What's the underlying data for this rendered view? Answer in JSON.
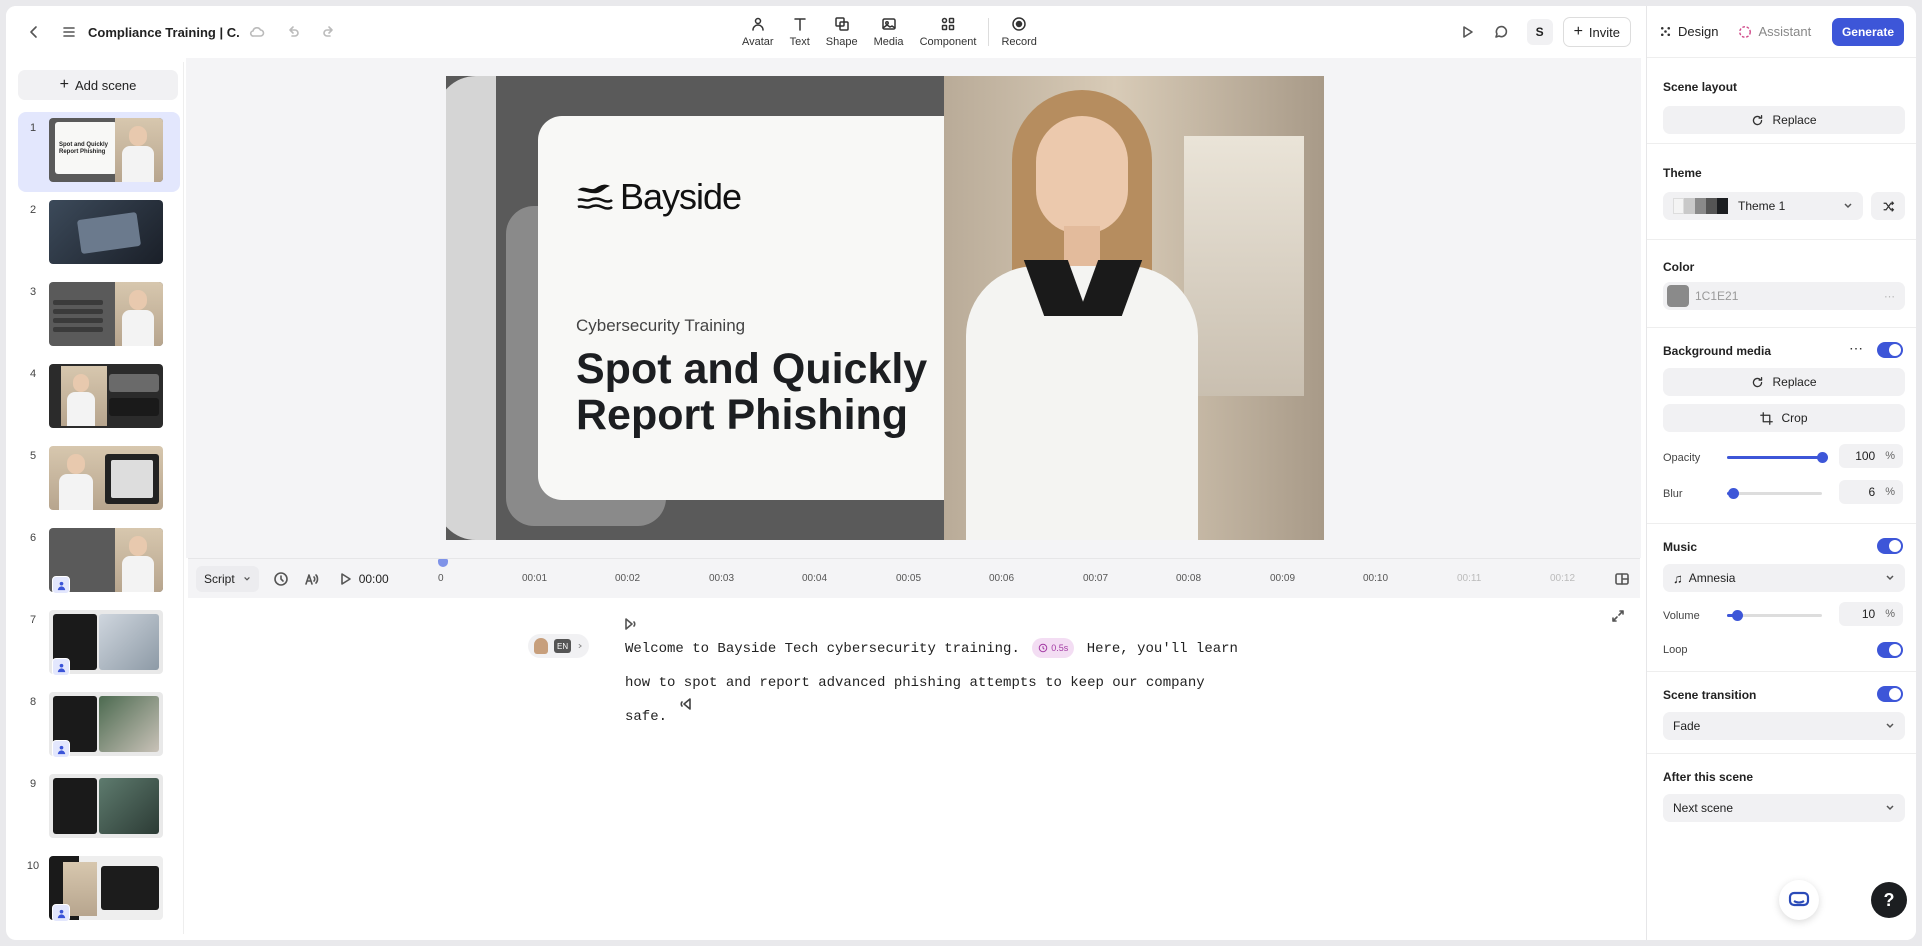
{
  "header": {
    "title": "Compliance Training | C...",
    "invite_label": "Invite",
    "user_initial": "S",
    "tools": [
      {
        "label": "Avatar",
        "icon": "avatar-icon"
      },
      {
        "label": "Text",
        "icon": "text-icon"
      },
      {
        "label": "Shape",
        "icon": "shape-icon"
      },
      {
        "label": "Media",
        "icon": "media-icon"
      },
      {
        "label": "Component",
        "icon": "component-icon"
      },
      {
        "label": "Record",
        "icon": "record-icon"
      }
    ]
  },
  "sidebar": {
    "add_scene_label": "Add scene",
    "scenes": [
      {
        "num": "1",
        "title_line1": "Spot and Quickly",
        "title_line2": "Report  Phishing"
      },
      {
        "num": "2"
      },
      {
        "num": "3"
      },
      {
        "num": "4"
      },
      {
        "num": "5"
      },
      {
        "num": "6"
      },
      {
        "num": "7"
      },
      {
        "num": "8"
      },
      {
        "num": "9"
      },
      {
        "num": "10"
      }
    ]
  },
  "slide": {
    "brand": "Bayside",
    "subtitle": "Cybersecurity Training",
    "title_line1": "Spot and Quickly",
    "title_line2": "Report  Phishing"
  },
  "timeline": {
    "script_label": "Script",
    "time": "00:00",
    "ticks": [
      "0",
      "00:01",
      "00:02",
      "00:03",
      "00:04",
      "00:05",
      "00:06",
      "00:07",
      "00:08",
      "00:09",
      "00:10",
      "00:11",
      "00:12"
    ]
  },
  "script": {
    "lang": "EN",
    "part1": "Welcome to Bayside Tech cybersecurity training.",
    "pause": "0.5s",
    "part2": "Here, you'll learn how to spot and report advanced phishing attempts to keep our company safe."
  },
  "panel": {
    "tab_design": "Design",
    "tab_assistant": "Assistant",
    "generate_label": "Generate",
    "scene_layout_title": "Scene layout",
    "replace_label": "Replace",
    "theme_title": "Theme",
    "theme_value": "Theme 1",
    "theme_swatches": [
      "#f4f4f4",
      "#c9c9c9",
      "#8a8a8a",
      "#555555",
      "#1c1e21"
    ],
    "color_title": "Color",
    "color_value": "1C1E21",
    "color_swatch": "#8a8a8a",
    "bg_media_title": "Background media",
    "bg_replace_label": "Replace",
    "crop_label": "Crop",
    "opacity_label": "Opacity",
    "opacity_value": "100",
    "opacity_fraction": 1.0,
    "blur_label": "Blur",
    "blur_value": "6",
    "blur_fraction": 0.06,
    "percent_unit": "%",
    "music_title": "Music",
    "music_value": "Amnesia",
    "volume_label": "Volume",
    "volume_value": "10",
    "volume_fraction": 0.1,
    "loop_label": "Loop",
    "transition_title": "Scene transition",
    "transition_value": "Fade",
    "after_title": "After this scene",
    "after_value": "Next scene"
  },
  "colors": {
    "accent": "#3d56d8",
    "slide_dark": "#5a5a5a",
    "slide_card": "#f8f8f6"
  }
}
